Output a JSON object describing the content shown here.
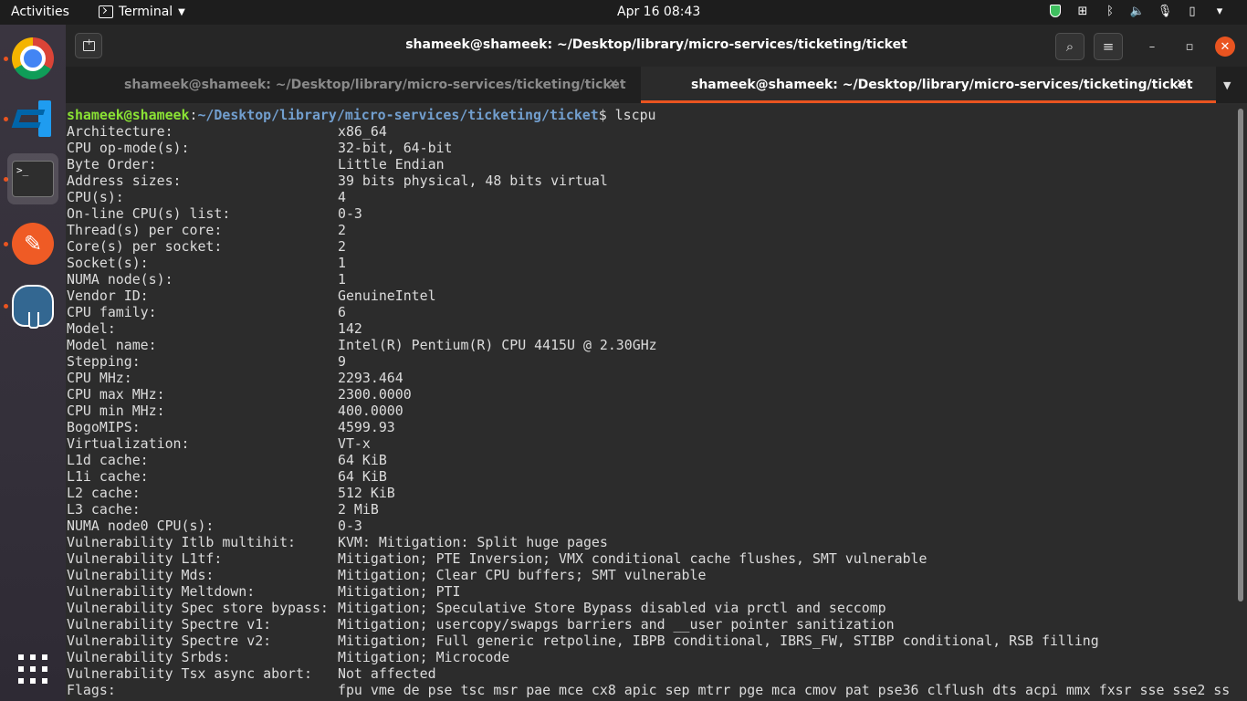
{
  "topbar": {
    "activities": "Activities",
    "app_name": "Terminal",
    "clock": "Apr 16  08:43",
    "tray_icons": [
      "shield-icon",
      "network-icon",
      "bluetooth-icon",
      "volume-icon",
      "microphone-icon",
      "battery-icon",
      "power-menu-icon"
    ]
  },
  "dock": {
    "items": [
      "Google Chrome",
      "Visual Studio Code",
      "Terminal",
      "Postman",
      "pgAdmin"
    ],
    "show_apps": "apps-grid-icon"
  },
  "window": {
    "title": "shameek@shameek: ~/Desktop/library/micro-services/ticketing/ticket",
    "tabs": [
      {
        "label": "shameek@shameek: ~/Desktop/library/micro-services/ticketing/ticket",
        "active": false
      },
      {
        "label": "shameek@shameek: ~/Desktop/library/micro-services/ticketing/ticket",
        "active": true
      }
    ]
  },
  "terminal": {
    "prompt_user": "shameek@shameek",
    "prompt_sep": ":",
    "prompt_path": "~/Desktop/library/micro-services/ticketing/ticket",
    "prompt_suffix": "$ ",
    "command": "lscpu",
    "rows": [
      [
        "Architecture:",
        "x86_64"
      ],
      [
        "CPU op-mode(s):",
        "32-bit, 64-bit"
      ],
      [
        "Byte Order:",
        "Little Endian"
      ],
      [
        "Address sizes:",
        "39 bits physical, 48 bits virtual"
      ],
      [
        "CPU(s):",
        "4"
      ],
      [
        "On-line CPU(s) list:",
        "0-3"
      ],
      [
        "Thread(s) per core:",
        "2"
      ],
      [
        "Core(s) per socket:",
        "2"
      ],
      [
        "Socket(s):",
        "1"
      ],
      [
        "NUMA node(s):",
        "1"
      ],
      [
        "Vendor ID:",
        "GenuineIntel"
      ],
      [
        "CPU family:",
        "6"
      ],
      [
        "Model:",
        "142"
      ],
      [
        "Model name:",
        "Intel(R) Pentium(R) CPU 4415U @ 2.30GHz"
      ],
      [
        "Stepping:",
        "9"
      ],
      [
        "CPU MHz:",
        "2293.464"
      ],
      [
        "CPU max MHz:",
        "2300.0000"
      ],
      [
        "CPU min MHz:",
        "400.0000"
      ],
      [
        "BogoMIPS:",
        "4599.93"
      ],
      [
        "Virtualization:",
        "VT-x"
      ],
      [
        "L1d cache:",
        "64 KiB"
      ],
      [
        "L1i cache:",
        "64 KiB"
      ],
      [
        "L2 cache:",
        "512 KiB"
      ],
      [
        "L3 cache:",
        "2 MiB"
      ],
      [
        "NUMA node0 CPU(s):",
        "0-3"
      ],
      [
        "Vulnerability Itlb multihit:",
        "KVM: Mitigation: Split huge pages"
      ],
      [
        "Vulnerability L1tf:",
        "Mitigation; PTE Inversion; VMX conditional cache flushes, SMT vulnerable"
      ],
      [
        "Vulnerability Mds:",
        "Mitigation; Clear CPU buffers; SMT vulnerable"
      ],
      [
        "Vulnerability Meltdown:",
        "Mitigation; PTI"
      ],
      [
        "Vulnerability Spec store bypass:",
        "Mitigation; Speculative Store Bypass disabled via prctl and seccomp"
      ],
      [
        "Vulnerability Spectre v1:",
        "Mitigation; usercopy/swapgs barriers and __user pointer sanitization"
      ],
      [
        "Vulnerability Spectre v2:",
        "Mitigation; Full generic retpoline, IBPB conditional, IBRS_FW, STIBP conditional, RSB filling"
      ],
      [
        "Vulnerability Srbds:",
        "Mitigation; Microcode"
      ],
      [
        "Vulnerability Tsx async abort:",
        "Not affected"
      ],
      [
        "Flags:",
        "fpu vme de pse tsc msr pae mce cx8 apic sep mtrr pge mca cmov pat pse36 clflush dts acpi mmx fxsr sse sse2 ss"
      ]
    ]
  },
  "colors": {
    "accent": "#e95420",
    "prompt_user": "#8ae234",
    "prompt_path": "#729fcf",
    "terminal_bg": "#2c2c2c",
    "terminal_fg": "#dcdcdc"
  }
}
